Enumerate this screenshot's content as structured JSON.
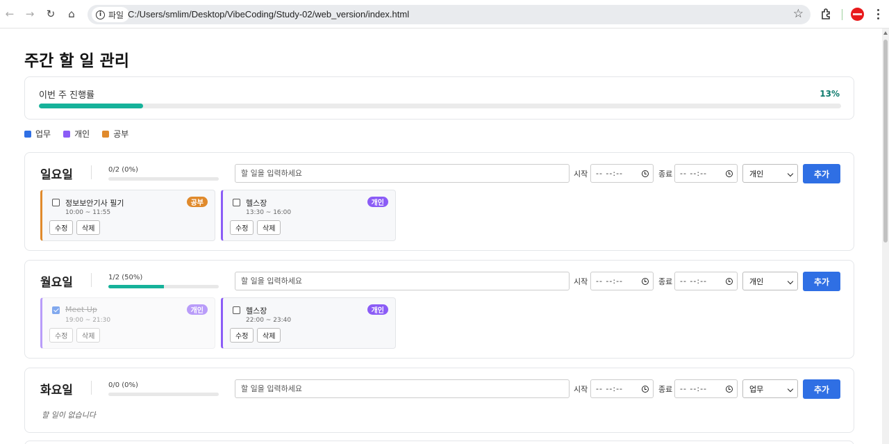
{
  "browser": {
    "site_chip": "파일",
    "url": "C:/Users/smlim/Desktop/VibeCoding/Study-02/web_version/index.html"
  },
  "page": {
    "title": "주간 할 일 관리",
    "weekly_progress": {
      "label": "이번 주 진행률",
      "percent_text": "13%",
      "percent": 13
    },
    "legend": [
      {
        "label": "업무",
        "color": "#2f6fe4"
      },
      {
        "label": "개인",
        "color": "#8b5cf6"
      },
      {
        "label": "공부",
        "color": "#e08a2c"
      }
    ],
    "category_colors": {
      "업무": "#2f6fe4",
      "개인": "#8b5cf6",
      "공부": "#e08a2c"
    }
  },
  "form_labels": {
    "input_placeholder": "할 일을 입력하세요",
    "start_label": "시작",
    "end_label": "종료",
    "time_placeholder": "-- --:--",
    "add_button": "추가",
    "edit_button": "수정",
    "delete_button": "삭제",
    "empty_text": "할 일이 없습니다"
  },
  "days": [
    {
      "name": "일요일",
      "count_text": "0/2 (0%)",
      "progress": 0,
      "category_select": "개인",
      "tasks": [
        {
          "title": "정보보안기사 필기",
          "time": "10:00 ~ 11:55",
          "category": "공부",
          "done": false
        },
        {
          "title": "헬스장",
          "time": "13:30 ~ 16:00",
          "category": "개인",
          "done": false
        }
      ]
    },
    {
      "name": "월요일",
      "count_text": "1/2 (50%)",
      "progress": 50,
      "category_select": "개인",
      "tasks": [
        {
          "title": "Meet Up",
          "time": "19:00 ~ 21:30",
          "category": "개인",
          "done": true
        },
        {
          "title": "헬스장",
          "time": "22:00 ~ 23:40",
          "category": "개인",
          "done": false
        }
      ]
    },
    {
      "name": "화요일",
      "count_text": "0/0 (0%)",
      "progress": 0,
      "category_select": "업무",
      "tasks": []
    }
  ]
}
